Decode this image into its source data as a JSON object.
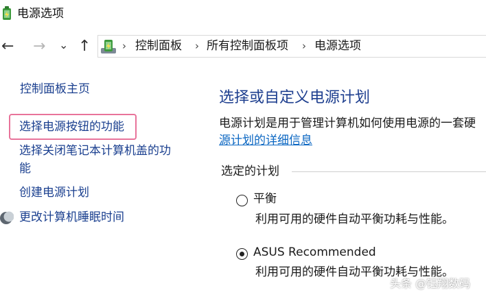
{
  "window": {
    "title": "电源选项",
    "icon": "power-options-icon"
  },
  "nav": {
    "back": "←",
    "forward": "→",
    "recent": "⌄",
    "up": "↑",
    "breadcrumb": [
      "控制面板",
      "所有控制面板项",
      "电源选项"
    ],
    "separator": "›"
  },
  "sidebar": {
    "items": [
      {
        "label": "控制面板主页"
      },
      {
        "label": "选择电源按钮的功能"
      },
      {
        "label_line1": "选择关闭笔记本计算机盖的功",
        "label_line2": "能"
      },
      {
        "label": "创建电源计划"
      },
      {
        "label": "更改计算机睡眠时间",
        "icon": "moon-icon"
      }
    ]
  },
  "main": {
    "title": "选择或自定义电源计划",
    "description": "电源计划是用于管理计算机如何使用电源的一套硬",
    "detail_link": "源计划的详细信息",
    "group_label": "选定的计划",
    "plans": [
      {
        "name": "平衡",
        "description": "利用可用的硬件自动平衡功耗与性能。",
        "selected": false
      },
      {
        "name": "ASUS Recommended",
        "description": "利用可用的硬件自动平衡功耗与性能。",
        "selected": true
      }
    ]
  },
  "watermark": "头条 @钰翔数码",
  "colors": {
    "link": "#1a3f8f",
    "title_blue": "#1e3f8f",
    "hyperlink": "#0a66c2",
    "highlight_border": "#e8739a"
  }
}
